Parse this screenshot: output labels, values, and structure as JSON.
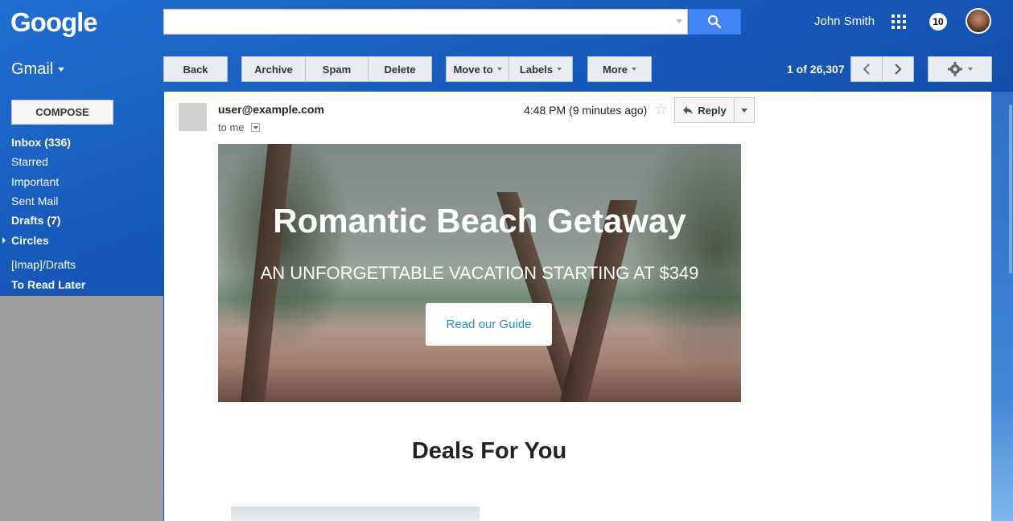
{
  "header": {
    "logo": "Google",
    "user_name": "John Smith",
    "notification_count": "10",
    "search_placeholder": ""
  },
  "toolbar": {
    "app_label": "Gmail",
    "back": "Back",
    "archive": "Archive",
    "spam": "Spam",
    "delete": "Delete",
    "move_to": "Move to",
    "labels": "Labels",
    "more": "More",
    "paging": "1 of 26,307"
  },
  "sidebar": {
    "compose": "COMPOSE",
    "items": [
      {
        "label": "Inbox (336)"
      },
      {
        "label": "Starred"
      },
      {
        "label": "Important"
      },
      {
        "label": "Sent Mail"
      },
      {
        "label": "Drafts (7)"
      },
      {
        "label": "Circles"
      },
      {
        "label": "[Imap]/Drafts"
      },
      {
        "label": "To Read Later"
      }
    ]
  },
  "email": {
    "sender": "user@example.com",
    "recipient": "to me",
    "time": "4:48 PM (9 minutes ago)",
    "reply": "Reply",
    "hero": {
      "title": "Romantic Beach Getaway",
      "subtitle": "AN UNFORGETTABLE VACATION STARTING AT $349",
      "button": "Read our Guide"
    },
    "section_title": "Deals For You"
  }
}
